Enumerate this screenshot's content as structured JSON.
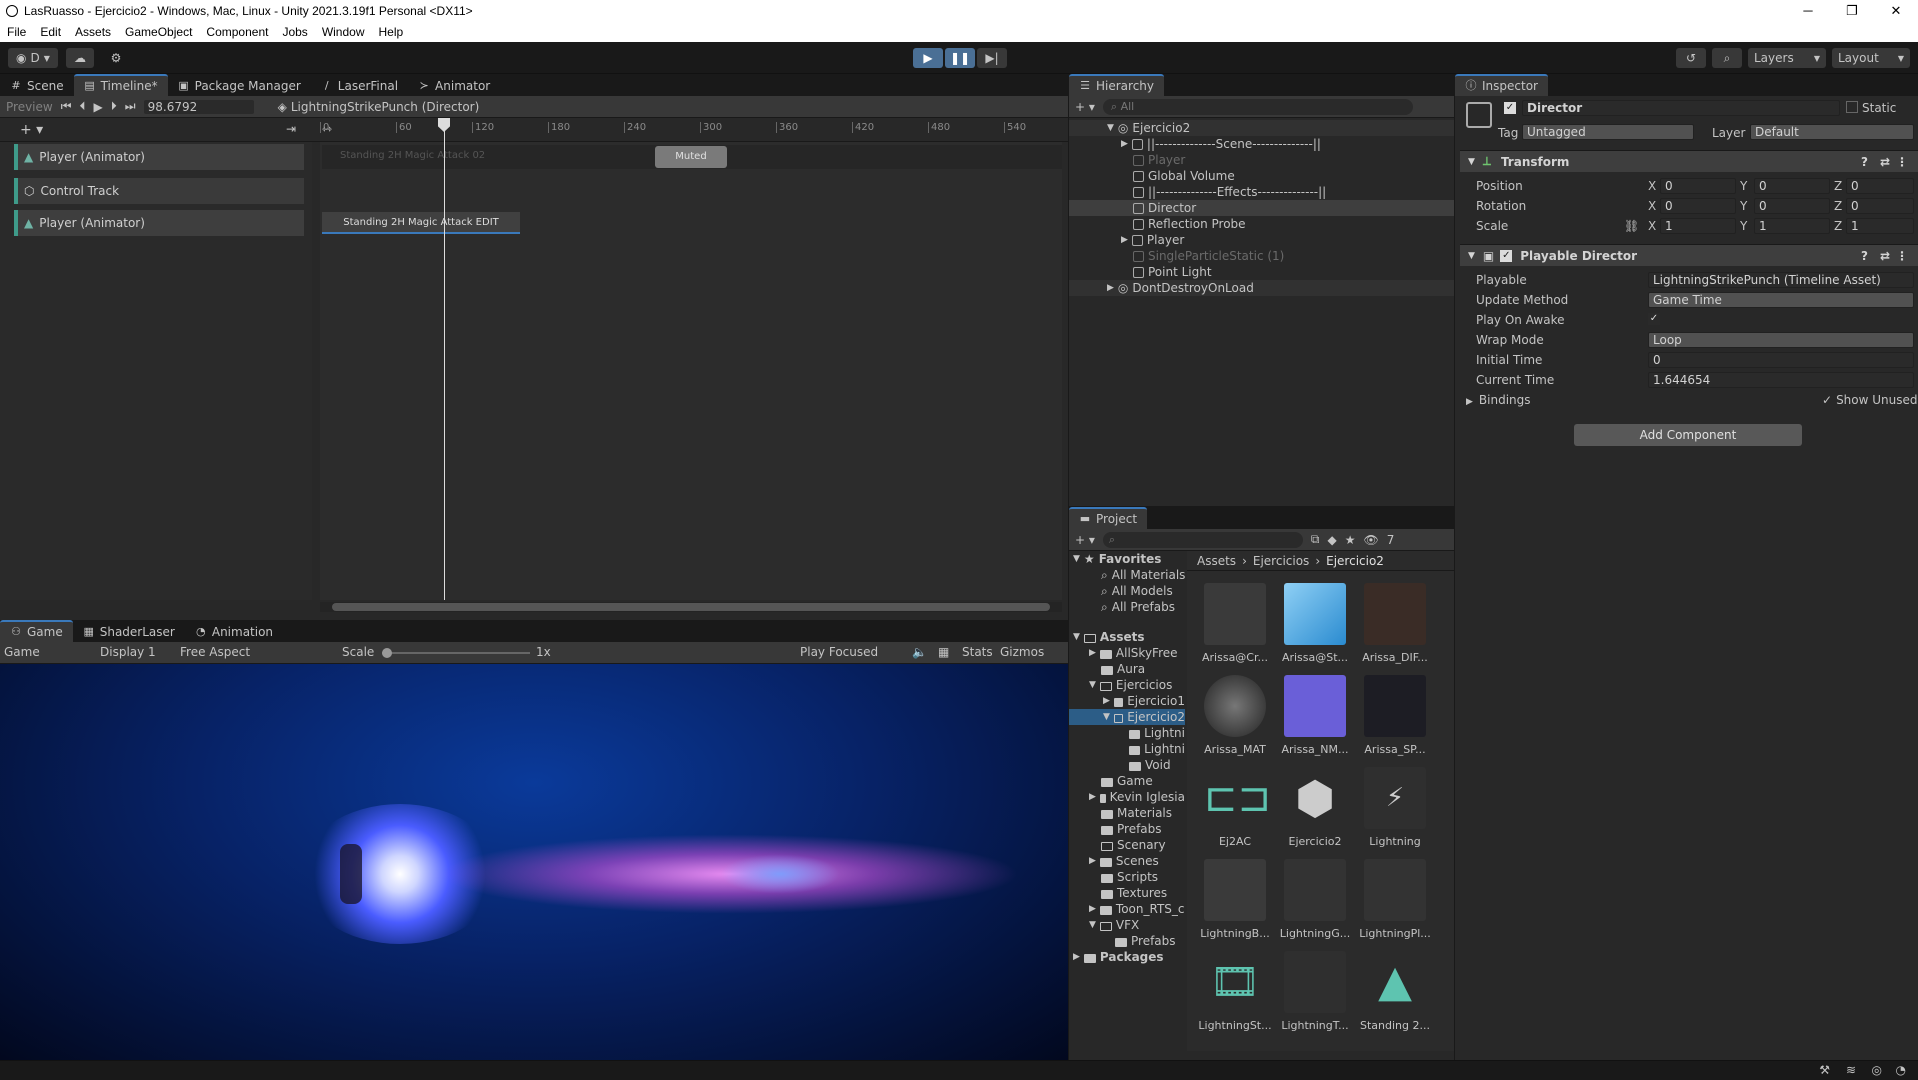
{
  "window": {
    "title": "LasRuasso - Ejercicio2 - Windows, Mac, Linux - Unity 2021.3.19f1 Personal <DX11>",
    "min": "─",
    "max": "❐",
    "close": "✕"
  },
  "menu": [
    "File",
    "Edit",
    "Assets",
    "GameObject",
    "Component",
    "Jobs",
    "Window",
    "Help"
  ],
  "toolbar": {
    "account": "D",
    "layers": "Layers",
    "layout": "Layout"
  },
  "timeline": {
    "tabs": [
      "Scene",
      "Timeline*",
      "Package Manager",
      "LaserFinal",
      "Animator"
    ],
    "preview": "Preview",
    "frame": "98.6792",
    "director": "LightningStrikePunch (Director)",
    "ruler": [
      "0",
      "60",
      "120",
      "180",
      "240",
      "300",
      "360",
      "420",
      "480",
      "540"
    ],
    "tracks": [
      {
        "name": "Player (Animator)"
      },
      {
        "name": "Control Track"
      },
      {
        "name": "Player (Animator)"
      }
    ],
    "clips": {
      "clip1": "Standing 2H Magic Attack 02",
      "muted": "Muted",
      "clip2": "Standing 2H Magic Attack EDIT"
    }
  },
  "game": {
    "tabs": [
      "Game",
      "ShaderLaser",
      "Animation"
    ],
    "mode": "Game",
    "display": "Display 1",
    "aspect": "Free Aspect",
    "scale_label": "Scale",
    "scale_value": "1x",
    "play_focused": "Play Focused",
    "stats": "Stats",
    "gizmos": "Gizmos"
  },
  "hierarchy": {
    "tab": "Hierarchy",
    "search_placeholder": "All",
    "items": [
      {
        "label": "Ejercicio2",
        "dim": false
      },
      {
        "label": "||--------------Scene--------------||",
        "dim": false
      },
      {
        "label": "Player",
        "dim": true
      },
      {
        "label": "Global Volume",
        "dim": false
      },
      {
        "label": "||--------------Effects--------------||",
        "dim": false
      },
      {
        "label": "Director",
        "dim": false
      },
      {
        "label": "Reflection Probe",
        "dim": false
      },
      {
        "label": "Player",
        "dim": false
      },
      {
        "label": "SingleParticleStatic (1)",
        "dim": true
      },
      {
        "label": "Point Light",
        "dim": false
      },
      {
        "label": "DontDestroyOnLoad",
        "dim": false
      }
    ]
  },
  "inspector": {
    "tab": "Inspector",
    "object_name": "Director",
    "static": "Static",
    "tag_label": "Tag",
    "tag_value": "Untagged",
    "layer_label": "Layer",
    "layer_value": "Default",
    "transform": "Transform",
    "position": "Position",
    "rotation": "Rotation",
    "scale": "Scale",
    "pos": [
      "0",
      "0",
      "0"
    ],
    "rot": [
      "0",
      "0",
      "0"
    ],
    "scl": [
      "1",
      "1",
      "1"
    ],
    "axes": [
      "X",
      "Y",
      "Z"
    ],
    "playable_director": "Playable Director",
    "fields": [
      {
        "label": "Playable",
        "value": "LightningStrikePunch (Timeline Asset)"
      },
      {
        "label": "Update Method",
        "value": "Game Time"
      },
      {
        "label": "Play On Awake",
        "value": "✓"
      },
      {
        "label": "Wrap Mode",
        "value": "Loop"
      },
      {
        "label": "Initial Time",
        "value": "0"
      },
      {
        "label": "Current Time",
        "value": "1.644654"
      }
    ],
    "bindings": "Bindings",
    "show_unused": "Show Unused",
    "add_component": "Add Component"
  },
  "project": {
    "tab": "Project",
    "count": "7",
    "breadcrumb": [
      "Assets",
      "Ejercicios",
      "Ejercicio2"
    ],
    "favorites": "Favorites",
    "fav_items": [
      "All Materials",
      "All Models",
      "All Prefabs"
    ],
    "assets_root": "Assets",
    "tree": [
      "AllSkyFree",
      "Aura",
      "Ejercicios",
      "Ejercicio1",
      "Ejercicio2",
      "Lightni",
      "Lightni",
      "Void",
      "Game",
      "Kevin Iglesia",
      "Materials",
      "Prefabs",
      "Scenary",
      "Scenes",
      "Scripts",
      "Textures",
      "Toon_RTS_c",
      "VFX",
      "Prefabs"
    ],
    "packages": "Packages",
    "assets": [
      "Arissa@Cr...",
      "Arissa@St...",
      "Arissa_DIF...",
      "Arissa_MAT",
      "Arissa_NM...",
      "Arissa_SP...",
      "Ej2AC",
      "Ejercicio2",
      "Lightning",
      "LightningB...",
      "LightningG...",
      "LightningPl...",
      "LightningSt...",
      "LightningT...",
      "Standing 2..."
    ]
  },
  "colors": {
    "accent": "#3a79bb",
    "track": "#3f9b8a",
    "selected": "#2c5d87"
  }
}
